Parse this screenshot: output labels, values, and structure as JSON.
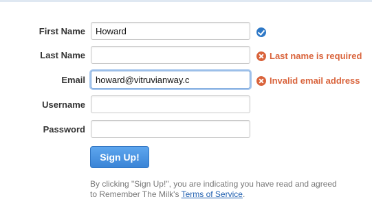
{
  "form": {
    "fields": {
      "first_name": {
        "label": "First Name",
        "value": "Howard",
        "status": "valid"
      },
      "last_name": {
        "label": "Last Name",
        "value": "",
        "error": "Last name is required"
      },
      "email": {
        "label": "Email",
        "value": "howard@vitruvianway.c",
        "error": "Invalid email address"
      },
      "username": {
        "label": "Username",
        "value": ""
      },
      "password": {
        "label": "Password",
        "value": ""
      }
    },
    "submit_label": "Sign Up!",
    "terms": {
      "text_before": "By clicking \"Sign Up!\", you are indicating you have read and agreed to Remember The Milk's",
      "link": "Terms of Service",
      "text_after": "."
    }
  },
  "icons": {
    "valid": "check-circle-icon",
    "error": "error-x-circle-icon"
  },
  "colors": {
    "accent": "#2e78c6",
    "error": "#d9633b",
    "button": "#4a93e0",
    "link": "#1f5fb0"
  }
}
